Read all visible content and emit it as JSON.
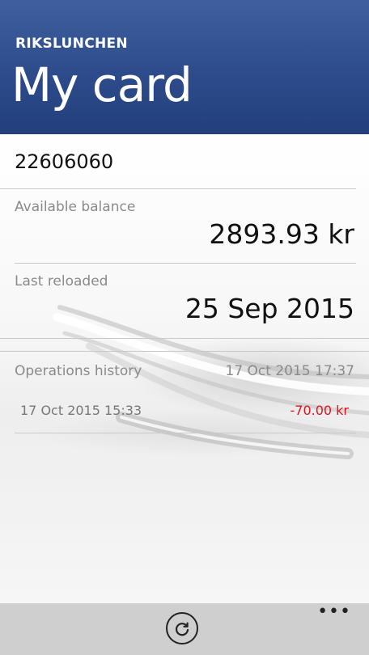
{
  "app": {
    "name": "RIKSLUNCHEN"
  },
  "page": {
    "title": "My card"
  },
  "card": {
    "number": "22606060"
  },
  "balance": {
    "label": "Available balance",
    "value": "2893.93 kr"
  },
  "reload": {
    "label": "Last reloaded",
    "value": "25 Sep 2015"
  },
  "history": {
    "label": "Operations history",
    "updated": "17 Oct 2015 17:37",
    "items": [
      {
        "date": "17 Oct 2015 15:33",
        "amount": "-70.00 kr"
      }
    ]
  },
  "appbar": {
    "refresh_icon": "refresh-icon",
    "more_label": "•••"
  },
  "colors": {
    "header": "#2c4a89",
    "negative": "#e0141e",
    "appbar": "#cfcfcf"
  }
}
